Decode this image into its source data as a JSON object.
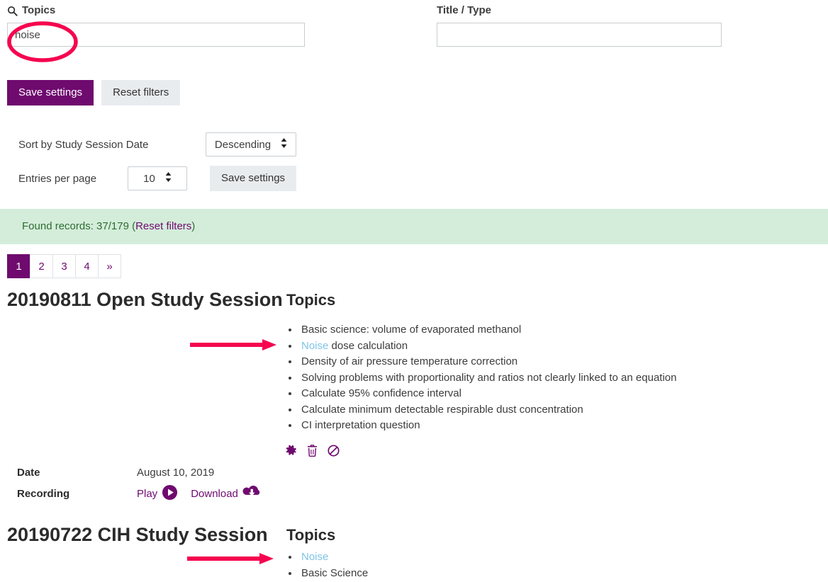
{
  "filters": {
    "topics": {
      "icon": "search-icon",
      "label": "Topics",
      "value": "noise",
      "placeholder": ""
    },
    "title_type": {
      "label": "Title / Type",
      "value": "",
      "placeholder": ""
    },
    "save_label": "Save settings",
    "reset_label": "Reset filters"
  },
  "settings": {
    "sort_label": "Sort by Study Session Date",
    "sort_value": "Descending",
    "entries_label": "Entries per page",
    "entries_value": "10",
    "save_label": "Save settings"
  },
  "alert": {
    "text": "Found records: 37/179 (",
    "reset_link": "Reset filters",
    "close_paren": ")"
  },
  "pagination": {
    "pages": [
      "1",
      "2",
      "3",
      "4",
      "»"
    ],
    "active_index": 0
  },
  "sessions": [
    {
      "title": "20190811 Open Study Session",
      "topics_heading": "Topics",
      "topics": [
        {
          "text": "Basic science: volume of evaporated methanol",
          "highlight": ""
        },
        {
          "text": " dose calculation",
          "highlight": "Noise"
        },
        {
          "text": "Density of air pressure temperature correction",
          "highlight": ""
        },
        {
          "text": "Solving problems with proportionality and ratios not clearly linked to an equation",
          "highlight": ""
        },
        {
          "text": "Calculate 95% confidence interval",
          "highlight": ""
        },
        {
          "text": "Calculate minimum detectable respirable dust concentration",
          "highlight": ""
        },
        {
          "text": "CI interpretation question",
          "highlight": ""
        }
      ],
      "actions": [
        "gear-icon",
        "trash-icon",
        "ban-icon"
      ],
      "date_label": "Date",
      "date_value": "August 10, 2019",
      "recording_label": "Recording",
      "play_label": "Play",
      "download_label": "Download"
    },
    {
      "title": "20190722 CIH Study Session",
      "topics_heading": "Topics",
      "topics": [
        {
          "text": "",
          "highlight": "Noise"
        },
        {
          "text": "Basic Science",
          "highlight": ""
        }
      ]
    }
  ],
  "colors": {
    "primary_purple": "#6f0a6f",
    "annotation_red": "#f5054f",
    "highlight_blue": "#7ec4e8",
    "alert_bg": "#d4edda",
    "alert_text": "#2e6b33"
  }
}
